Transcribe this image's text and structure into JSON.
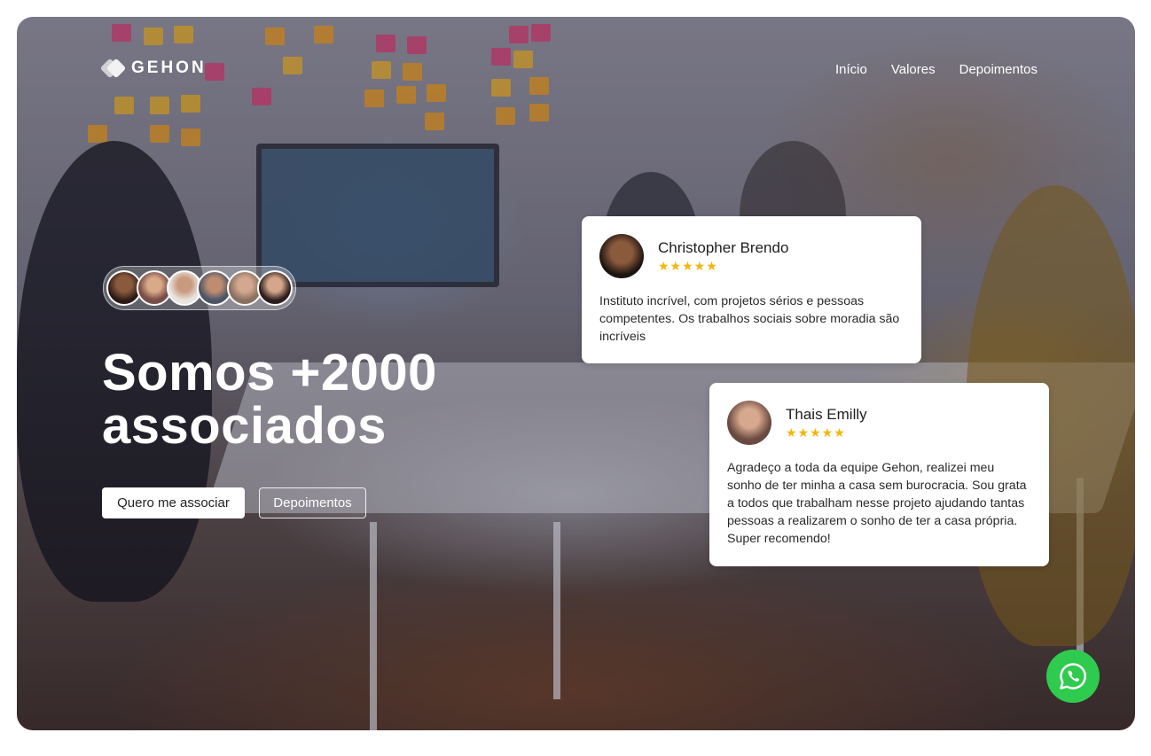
{
  "brand": {
    "name": "GEHON"
  },
  "nav": {
    "items": [
      "Início",
      "Valores",
      "Depoimentos"
    ]
  },
  "hero": {
    "title_line1_regular": "Somos ",
    "title_line1_bold": "+2000",
    "title_line2": "associados",
    "primary_button": "Quero me associar",
    "secondary_button": "Depoimentos",
    "avatar_count": 6
  },
  "testimonials": [
    {
      "name": "Christopher Brendo",
      "rating": 5,
      "stars": "★★★★★",
      "text": "Instituto incrível, com projetos sérios e pessoas competentes. Os trabalhos sociais sobre moradia são incríveis"
    },
    {
      "name": "Thais Emilly",
      "rating": 5,
      "stars": "★★★★★",
      "text": "Agradeço a toda da equipe Gehon, realizei meu sonho de ter minha a casa sem burocracia. Sou grata a todos que trabalham nesse projeto ajudando tantas pessoas a realizarem o sonho de ter a casa própria. Super recomendo!"
    }
  ],
  "colors": {
    "star": "#f5b50a",
    "whatsapp": "#2fcb4e",
    "card_bg": "#ffffff"
  },
  "icons": {
    "whatsapp": "whatsapp-icon",
    "logo": "gehon-logo-icon"
  }
}
